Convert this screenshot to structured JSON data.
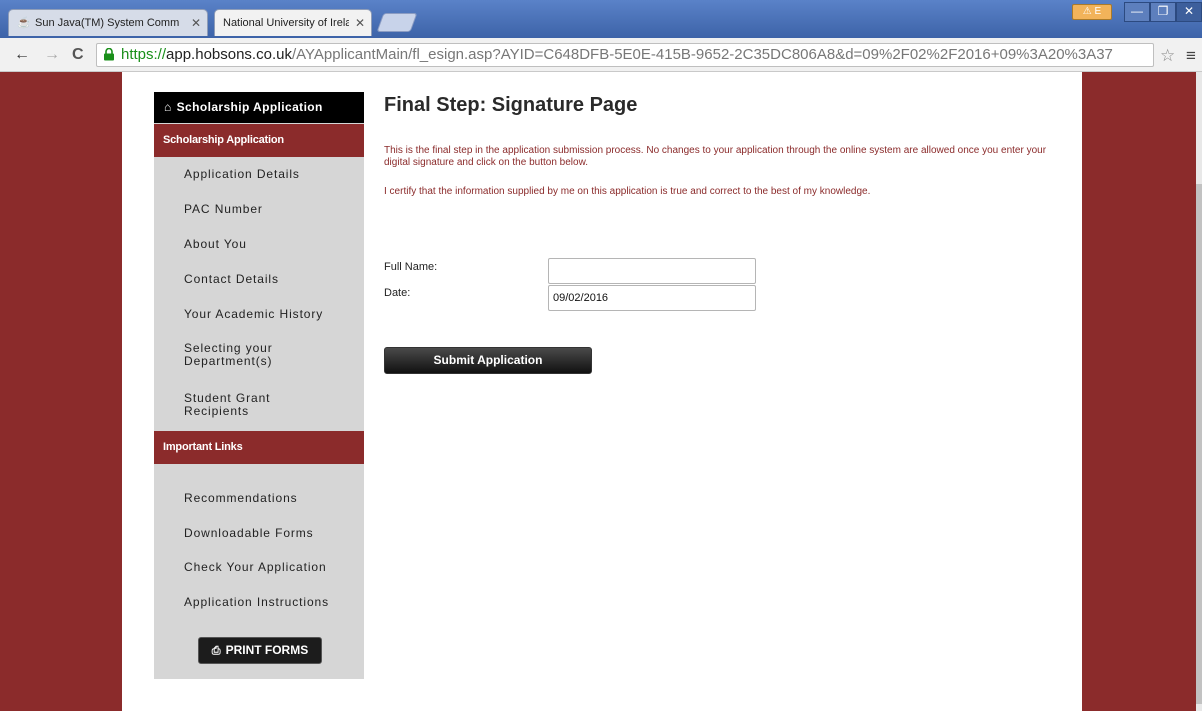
{
  "browser": {
    "tabs": [
      {
        "title": "Sun Java(TM) System Comm",
        "icon": "java-icon"
      },
      {
        "title": "National University of Ireland"
      }
    ],
    "warning_badge": "⚠ E",
    "url": {
      "scheme": "https://",
      "host": "app.hobsons.co.uk",
      "path": "/AYApplicantMain/fl_esign.asp?AYID=C648DFB-5E0E-415B-9652-2C35DC806A8&d=09%2F02%2F2016+09%3A20%3A37"
    }
  },
  "sidebar": {
    "home_label": "Scholarship Application",
    "section1_label": "Scholarship Application",
    "items": [
      "Application Details",
      "PAC Number",
      "About You",
      "Contact Details",
      "Your Academic History",
      "Selecting your\nDepartment(s)",
      "Student Grant\nRecipients"
    ],
    "section2_label": "Important Links",
    "links": [
      "Recommendations",
      "Downloadable Forms",
      "Check Your Application",
      "Application Instructions"
    ],
    "print_label": "PRINT FORMS"
  },
  "main": {
    "title": "Final Step: Signature Page",
    "intro": "This is the final step in the application submission process. No changes to your application through the online system are allowed once you enter your digital signature and click on the button below.",
    "certify": "I certify that the information supplied by me on this application is true and correct to the best of my knowledge.",
    "full_name_label": "Full Name:",
    "full_name_value": "",
    "date_label": "Date:",
    "date_value": "09/02/2016",
    "submit_label": "Submit Application"
  },
  "colors": {
    "brand": "#8b2b2b",
    "sidebar_bg": "#d6d6d6"
  }
}
